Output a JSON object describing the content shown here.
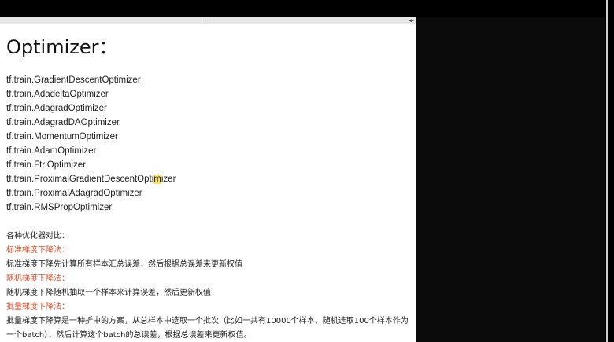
{
  "title": "Optimizer：",
  "optimizers": [
    "tf.train.GradientDescentOptimizer",
    "tf.train.AdadeltaOptimizer",
    "tf.train.AdagradOptimizer",
    "tf.train.AdagradDAOptimizer",
    "tf.train.MomentumOptimizer",
    "tf.train.AdamOptimizer",
    "tf.train.FtrlOptimizer",
    "tf.train.ProximalGradientDescentOptimizer",
    "tf.train.ProximalAdagradOptimizer",
    "tf.train.RMSPropOptimizer"
  ],
  "proximal_gd_parts": {
    "before": "tf.train.ProximalGradientDescentOpti",
    "highlighted": "m",
    "after": "izer"
  },
  "notes": {
    "comparison_heading": "各种优化器对比：",
    "standard_heading": "标准梯度下降法：",
    "standard_text": "标准梯度下降先计算所有样本汇总误差，然后根据总误差来更新权值",
    "stochastic_heading": "随机梯度下降法：",
    "stochastic_text": "随机梯度下降随机抽取一个样本来计算误差，然后更新权值",
    "batch_heading": "批量梯度下降法：",
    "batch_text": "批量梯度下降算是一种折中的方案，从总样本中选取一个批次（比如一共有10000个样本，随机选取100个样本作为一个batch），然后计算这个batch的总误差，根据总误差来更新权值。"
  },
  "colors": {
    "heading_red": "#d9532f",
    "highlight": "#f5e06a"
  },
  "icons": {
    "splitter_grip": "····",
    "collapse_arrows": "◂▸"
  }
}
